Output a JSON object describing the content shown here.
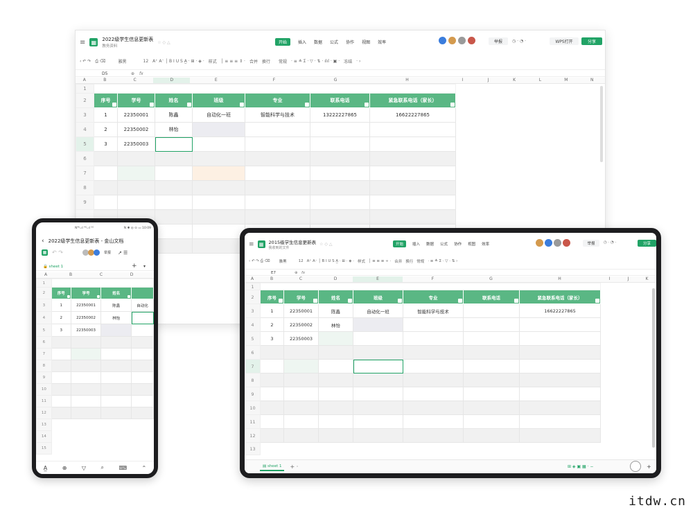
{
  "desktop": {
    "title": "2022级学生信息更新表",
    "folder": "教务资料",
    "menu": [
      "开始",
      "插入",
      "数据",
      "公式",
      "协作",
      "视图",
      "效率"
    ],
    "btn_report": "举报",
    "btn_wps": "WPS打开",
    "btn_share": "分享",
    "font_name": "雅黑",
    "font_size": "12",
    "style_label": "样式",
    "merge_label": "合并",
    "wrap_label": "换行",
    "format_label": "常规",
    "freeze_label": "冻结",
    "cell_ref": "D5",
    "fx": "fx",
    "columns": [
      "A",
      "B",
      "C",
      "D",
      "E",
      "F",
      "G",
      "H",
      "I",
      "J",
      "K",
      "L",
      "M",
      "N"
    ],
    "headers": [
      "序号",
      "学号",
      "姓名",
      "班级",
      "专业",
      "联系电话",
      "紧急联系电话（家长）"
    ],
    "rows": [
      [
        "1",
        "22350001",
        "陈鑫",
        "自动化一班",
        "智能科学与技术",
        "13222227865",
        "16622227865"
      ],
      [
        "2",
        "22350002",
        "林怡",
        "",
        "",
        "",
        ""
      ],
      [
        "3",
        "22350003",
        "",
        "",
        "",
        "",
        ""
      ]
    ],
    "row_nums": [
      "1",
      "2",
      "3",
      "4",
      "5",
      "6",
      "7",
      "8",
      "9"
    ]
  },
  "tablet": {
    "title": "2015级学生信息更新表",
    "folder": "我收到的文件",
    "menu": [
      "开始",
      "插入",
      "数据",
      "公式",
      "协作",
      "视图",
      "效率"
    ],
    "btn_report": "举报",
    "btn_share": "分享",
    "font_name": "雅黑",
    "font_size": "12",
    "style_label": "样式",
    "merge_label": "合并",
    "wrap_label": "换行",
    "format_label": "常规",
    "cell_ref": "E7",
    "fx": "fx",
    "columns": [
      "A",
      "B",
      "C",
      "D",
      "E",
      "F",
      "G",
      "H",
      "I",
      "J",
      "K"
    ],
    "headers": [
      "序号",
      "学号",
      "姓名",
      "班级",
      "专业",
      "联系电话",
      "紧急联系电话（家长）"
    ],
    "rows": [
      [
        "1",
        "22350001",
        "陈鑫",
        "自动化一班",
        "智能科学与技术",
        "",
        "16622227865"
      ],
      [
        "2",
        "22350002",
        "林怡",
        "",
        "",
        "",
        ""
      ],
      [
        "3",
        "22350003",
        "",
        "",
        "",
        "",
        ""
      ]
    ],
    "row_nums": [
      "1",
      "2",
      "3",
      "4",
      "5",
      "6",
      "7",
      "8",
      "9",
      "10",
      "11",
      "12",
      "13"
    ],
    "sheet_tab": "sheet 1"
  },
  "phone": {
    "status_left": "N⁴⁶ᵢ.ıl ⁴ᴳᵢ.ıl ⁵ᴳ",
    "status_right": "N ✱ ◎ ⊙ ▭ 10:09",
    "title": "2022级学生信息更新表 - 金山文档",
    "report": "举报",
    "sheet_tab": "sheet 1",
    "columns": [
      "A",
      "B",
      "C",
      "D"
    ],
    "headers": [
      "序号",
      "学号",
      "姓名",
      ""
    ],
    "rows": [
      [
        "1",
        "22350001",
        "陈鑫",
        "自动化"
      ],
      [
        "2",
        "22350002",
        "林怡",
        ""
      ],
      [
        "3",
        "22350003",
        "",
        ""
      ]
    ],
    "row_nums": [
      "1",
      "2",
      "3",
      "4",
      "5",
      "6",
      "7",
      "8",
      "9",
      "10",
      "11",
      "12",
      "13",
      "14",
      "15"
    ]
  },
  "watermark": "itdw.cn",
  "colors": {
    "accent": "#21a366",
    "header": "#5ab784",
    "frame": "#1d1d1f"
  }
}
